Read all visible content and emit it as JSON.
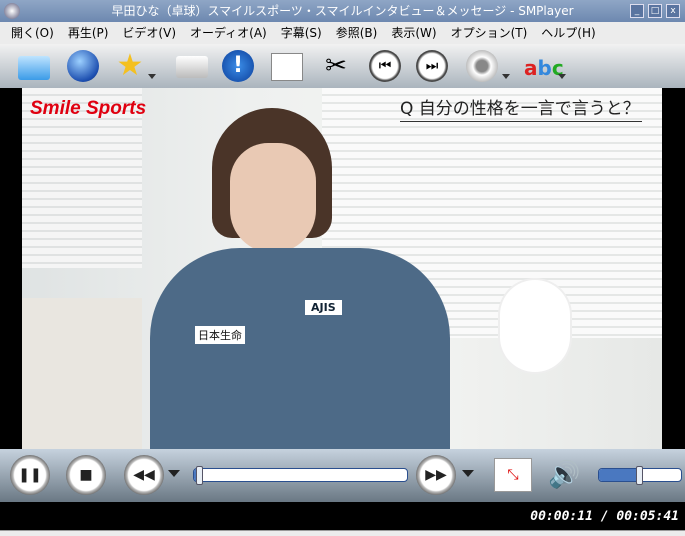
{
  "window": {
    "title": "早田ひな（卓球）スマイルスポーツ・スマイルインタビュー＆メッセージ - SMPlayer",
    "minimize": "_",
    "maximize": "□",
    "close": "x"
  },
  "menu": [
    {
      "label": "開く(O)"
    },
    {
      "label": "再生(P)"
    },
    {
      "label": "ビデオ(V)"
    },
    {
      "label": "オーディオ(A)"
    },
    {
      "label": "字幕(S)"
    },
    {
      "label": "参照(B)"
    },
    {
      "label": "表示(W)"
    },
    {
      "label": "オプション(T)"
    },
    {
      "label": "ヘルプ(H)"
    }
  ],
  "toolbar": [
    "open-folder-icon",
    "globe-icon",
    "favorites-star-icon",
    "screenshot-camera-icon",
    "info-icon",
    "playlist-icon",
    "preferences-tools-icon",
    "previous-icon",
    "next-icon",
    "audio-speaker-icon",
    "subtitles-abc-icon"
  ],
  "video": {
    "logo": "Smile Sports",
    "caption": "Q 自分の性格を一言で言うと？",
    "jacket_text_1": "AJIS",
    "jacket_text_2": "日本生命"
  },
  "controls": {
    "pause": "❚❚",
    "stop": "■",
    "rewind": "◀◀",
    "forward": "▶▶",
    "seek_progress_percent": 3,
    "volume_percent": 50
  },
  "status": {
    "time": "00:00:11 / 00:05:41"
  },
  "colors": {
    "titlebar": "#7a93ba",
    "logo": "#e00010"
  }
}
